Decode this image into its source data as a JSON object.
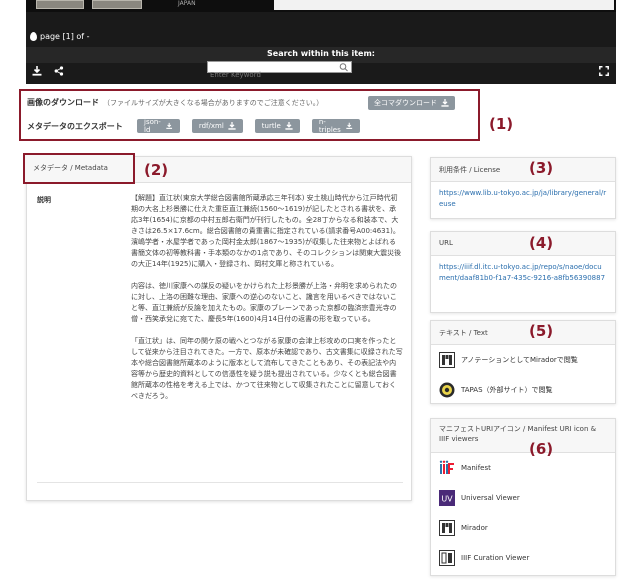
{
  "viewer": {
    "thumb_caption": "JAPAN",
    "page_indicator": "page [1] of -",
    "search_label": "Search within this item:",
    "search_placeholder": "Enter Keyword",
    "icons": [
      "download-icon",
      "share-icon",
      "fullscreen-icon",
      "search-icon"
    ]
  },
  "download": {
    "label": "画像のダウンロード",
    "note": "（ファイルサイズが大きくなる場合がありますのでご注意ください。）",
    "all_button": "全コマダウンロード"
  },
  "export": {
    "label": "メタデータのエクスポート",
    "buttons": [
      "json-ld",
      "rdf/xml",
      "turtle",
      "n-triples"
    ]
  },
  "annotations": [
    "(1)",
    "(2)",
    "(3)",
    "(4)",
    "(5)",
    "(6)"
  ],
  "metadata": {
    "title": "メタデータ / Metadata",
    "desc_label": "説明",
    "paragraphs": [
      "【解題】直江状(東京大学総合図書館所蔵承応三年刊本) 安土桃山時代から江戸時代初期の大名上杉景勝に仕えた重臣直江兼続(1560～1619)が記したとされる書状を、承応3年(1654)に京都の中村五郎右衛門が刊行したもの。全28丁からなる和装本で、大きさは26.5×17.6cm。総合図書館の貴重書に指定されている(請求番号A00:4631)。濱嶋学者・水屋学者であった岡村金太郎(1867～1935)が収集した往来物とよばれる書簡文体の初等教科書・手本類のなかの1点であり、そのコレクションは関東大震災後の大正14年(1925)に購入・登録され、岡村文庫と称されている。",
      "内容は、徳川家康への謀反の疑いをかけられた上杉景勝が上洛・弁明を求められたのに対し、上洛の困難な理由、家康への逆心のないこと、讒言を用いるべきではないこと等、直江兼続が反論を加えたもの。家康のブレーンであった京都の臨済宗豊光寺の僧・西笑承兌に宛てた、慶長5年(1600)4月14日付の返書の形を取っている。",
      "「直江状」は、同年の関ケ原の戦へとつながる家康の会津上杉攻めの口実を作ったとして従来から注目されてきた。一方で、原本が未確認であり、古文書集に収録された写本や総合図書館所蔵本のように版本として流布してきたこともあり、その表記法や内容等から歴史的資料としての信憑性を疑う説も提出されている。少なくとも総合図書館所蔵本の性格を考える上では、かつて往来物として収集されたことに留意しておくべきだろう。"
    ]
  },
  "license": {
    "title": "利用条件 / License",
    "link": "https://www.lib.u-tokyo.ac.jp/ja/library/general/reuse"
  },
  "url": {
    "title": "URL",
    "link": "https://iiif.dl.itc.u-tokyo.ac.jp/repo/s/naoe/document/daaf81b0-f1a7-435c-9216-a8fb56390887"
  },
  "text": {
    "title": "テキスト / Text",
    "items": [
      "アノテーションとしてMiradorで閲覧",
      "TAPAS（外部サイト）で閲覧"
    ]
  },
  "manifest": {
    "title": "マニフェストURIアイコン / Manifest URI icon & IIIF viewers",
    "items": [
      "Manifest",
      "Universal Viewer",
      "Mirador",
      "IIIF Curation Viewer"
    ]
  },
  "colors": {
    "accent": "#8b1a2b",
    "button": "#8c969e",
    "link": "#2b6fae"
  }
}
